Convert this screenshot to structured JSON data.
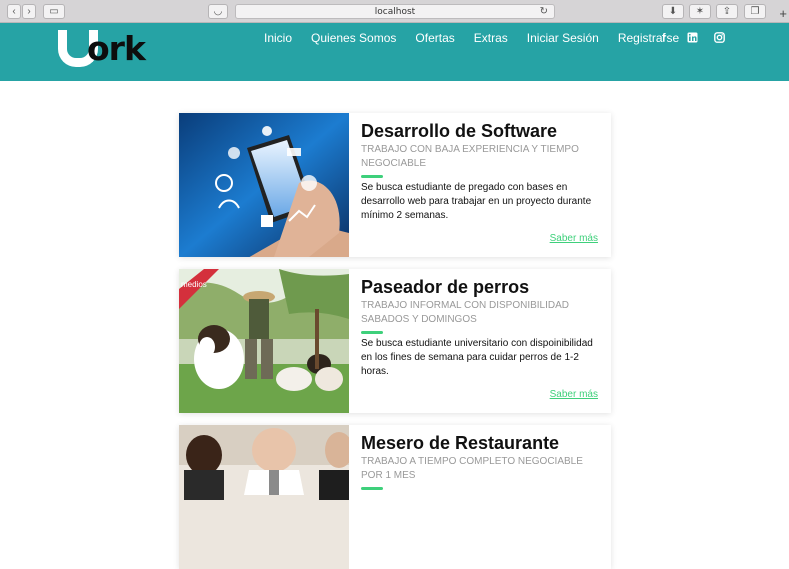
{
  "browser": {
    "url": "localhost"
  },
  "brand": {
    "logo_text": "ork",
    "logo_letter": "U"
  },
  "nav": {
    "items": [
      "Inicio",
      "Quienes Somos",
      "Ofertas",
      "Extras",
      "Iniciar Sesión",
      "Registrarse"
    ],
    "social": [
      "f",
      "in",
      "ig"
    ]
  },
  "jobs": [
    {
      "title": "Desarrollo de Software",
      "subtitle": "TRABAJO CON BAJA EXPERIENCIA Y TIEMPO NEGOCIABLE",
      "description": "Se busca estudiante de pregado con bases en desarrollo web para trabajar en un proyecto durante mínimo 2 semanas.",
      "link": "Saber más",
      "image": "smartphone-tech-photo"
    },
    {
      "title": "Paseador de perros",
      "subtitle": "TRABAJO INFORMAL CON DISPONIBILIDAD SABADOS Y DOMINGOS",
      "description": "Se busca estudiante universitario con dispoinibilidad en los fines de semana para cuidar perros de 1-2 horas.",
      "link": "Saber más",
      "image": "dog-walker-photo",
      "badge": "medios"
    },
    {
      "title": "Mesero de Restaurante",
      "subtitle": "TRABAJO A TIEMPO COMPLETO NEGOCIABLE POR 1 MES",
      "description": "",
      "link": "",
      "image": "waiter-photo"
    }
  ],
  "colors": {
    "nav_bg": "#26a3a5",
    "accent": "#3ed07b"
  }
}
